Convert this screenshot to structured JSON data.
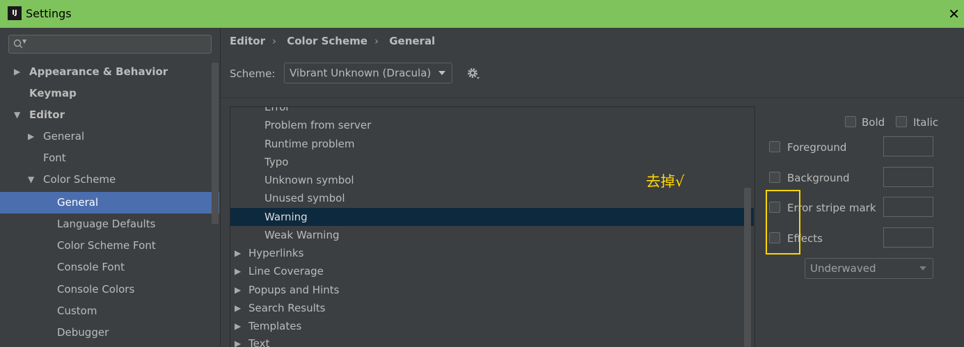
{
  "window": {
    "title": "Settings",
    "app_icon": "IJ"
  },
  "sidebar": {
    "search_placeholder": "",
    "items": [
      {
        "label": "Appearance & Behavior",
        "expanded": false
      },
      {
        "label": "Keymap"
      },
      {
        "label": "Editor",
        "expanded": true
      },
      {
        "label": "General",
        "expanded": false
      },
      {
        "label": "Font"
      },
      {
        "label": "Color Scheme",
        "expanded": true
      },
      {
        "label": "General",
        "selected": true
      },
      {
        "label": "Language Defaults"
      },
      {
        "label": "Color Scheme Font"
      },
      {
        "label": "Console Font"
      },
      {
        "label": "Console Colors"
      },
      {
        "label": "Custom"
      },
      {
        "label": "Debugger"
      }
    ]
  },
  "breadcrumb": [
    "Editor",
    "Color Scheme",
    "General"
  ],
  "scheme": {
    "label": "Scheme:",
    "value": "Vibrant Unknown (Dracula)"
  },
  "list": {
    "items": [
      {
        "label": "Error"
      },
      {
        "label": "Problem from server"
      },
      {
        "label": "Runtime problem"
      },
      {
        "label": "Typo"
      },
      {
        "label": "Unknown symbol"
      },
      {
        "label": "Unused symbol"
      },
      {
        "label": "Warning",
        "selected": true
      },
      {
        "label": "Weak Warning"
      },
      {
        "label": "Hyperlinks",
        "group": true
      },
      {
        "label": "Line Coverage",
        "group": true
      },
      {
        "label": "Popups and Hints",
        "group": true
      },
      {
        "label": "Search Results",
        "group": true
      },
      {
        "label": "Templates",
        "group": true
      },
      {
        "label": "Text",
        "group": true
      }
    ]
  },
  "annotation": "去掉√",
  "properties": {
    "bold": "Bold",
    "italic": "Italic",
    "foreground": "Foreground",
    "background": "Background",
    "error_stripe": "Error stripe mark",
    "effects": "Effects",
    "effect_type": "Underwaved"
  },
  "colors": {
    "accent": "#4b6eaf",
    "titlebar": "#7ec35c",
    "highlight": "#ffd700",
    "selected_row": "#0d293e"
  }
}
